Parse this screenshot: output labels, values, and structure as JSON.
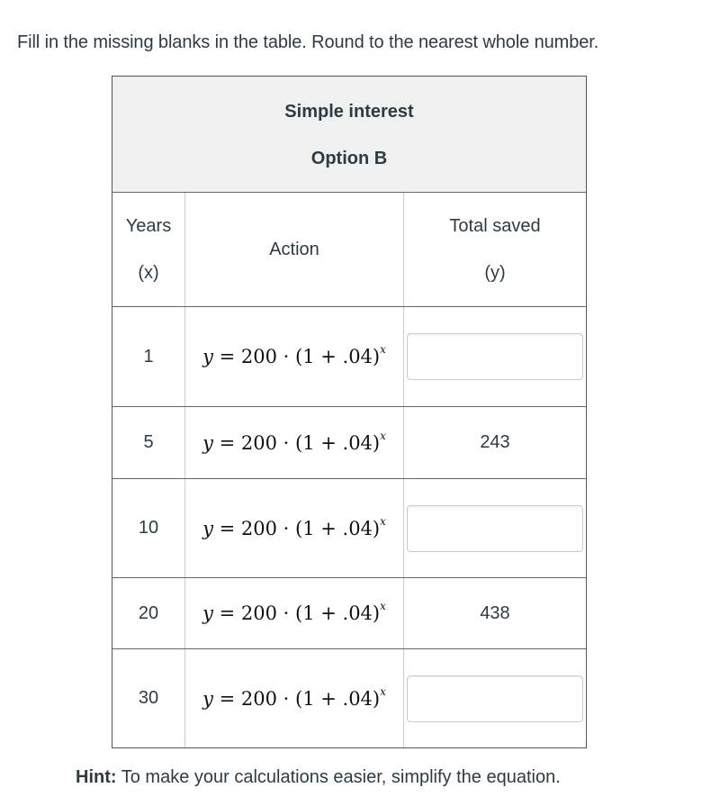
{
  "instruction": "Fill in the missing blanks in the table. Round to the nearest whole number.",
  "table": {
    "title_line1": "Simple interest",
    "title_line2": "Option B",
    "headers": {
      "years_line1": "Years",
      "years_line2": "(x)",
      "action": "Action",
      "total_line1": "Total saved",
      "total_line2": "(y)"
    },
    "equation": {
      "lhs": "y",
      "rhs_text": " = 200 · (1 + .04)",
      "exponent": "x"
    },
    "rows": [
      {
        "years": "1",
        "total": null,
        "input_value": ""
      },
      {
        "years": "5",
        "total": "243"
      },
      {
        "years": "10",
        "total": null,
        "input_value": ""
      },
      {
        "years": "20",
        "total": "438"
      },
      {
        "years": "30",
        "total": null,
        "input_value": ""
      }
    ]
  },
  "hint": {
    "label": "Hint:",
    "text": " To make your calculations easier, simplify the equation."
  }
}
